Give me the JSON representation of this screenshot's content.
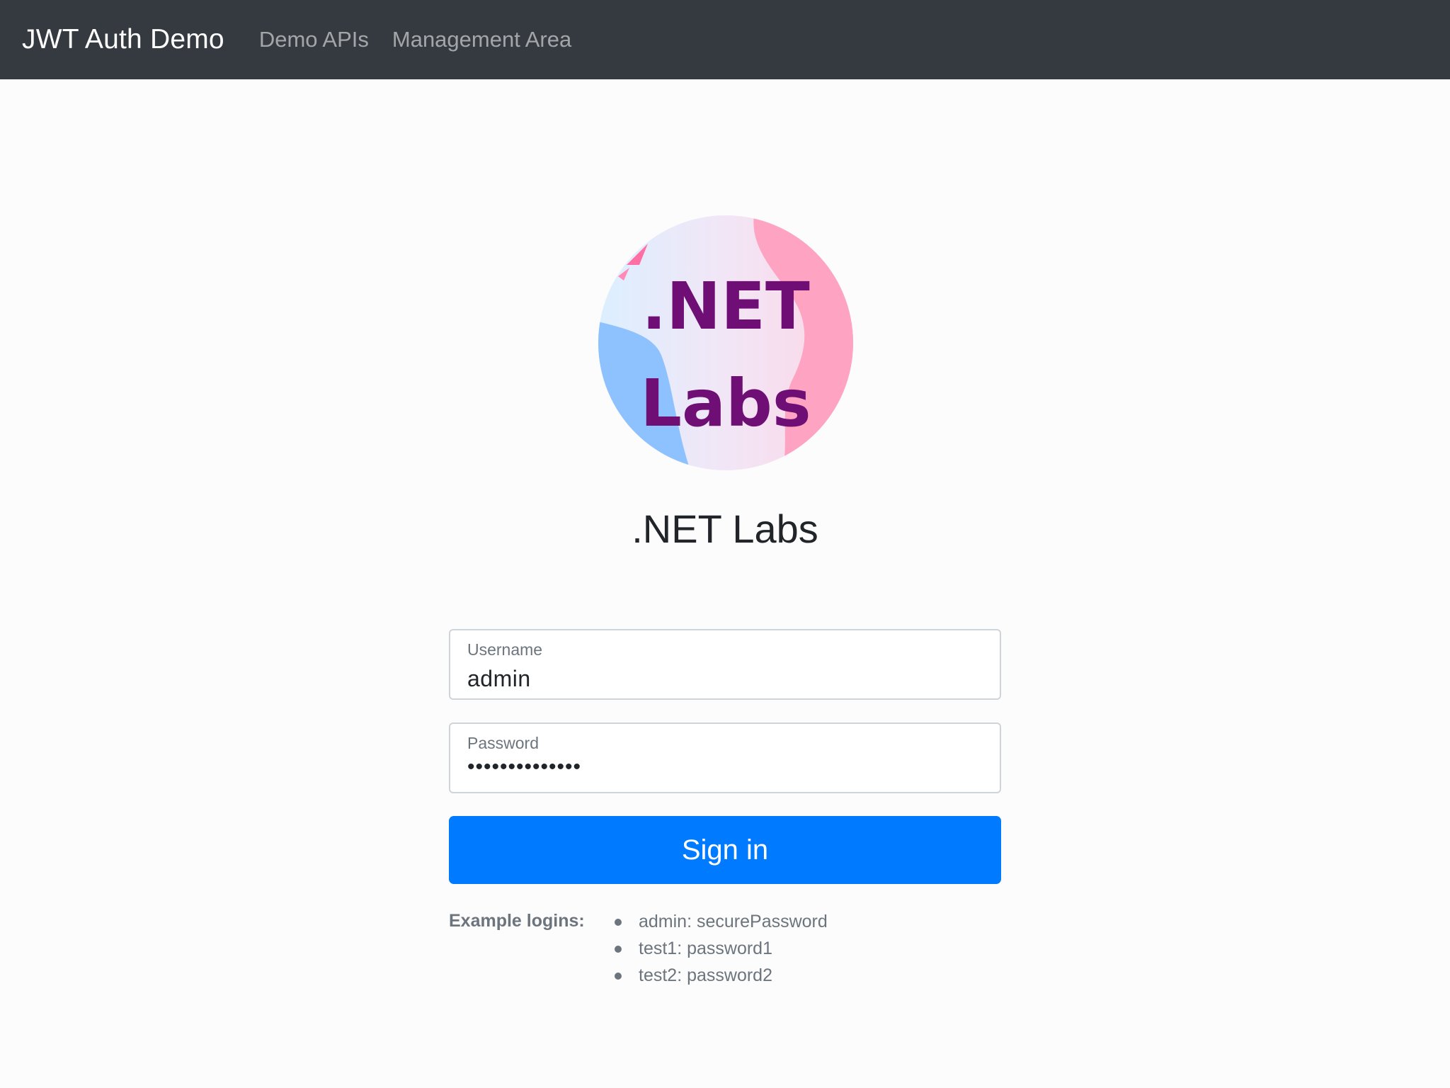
{
  "navbar": {
    "brand": "JWT Auth Demo",
    "links": [
      "Demo APIs",
      "Management Area"
    ]
  },
  "logo": {
    "line1": ".NET",
    "line2": "Labs",
    "text_color": "#6f0f75"
  },
  "page": {
    "title": ".NET Labs"
  },
  "form": {
    "username_label": "Username",
    "username_value": "admin",
    "password_label": "Password",
    "password_value": "••••••••••••••",
    "signin_label": "Sign in"
  },
  "examples": {
    "label": "Example logins:",
    "items": [
      "admin: securePassword",
      "test1: password1",
      "test2: password2"
    ]
  },
  "colors": {
    "navbar_bg": "#343a40",
    "primary": "#007bff",
    "muted": "#6c757d"
  }
}
